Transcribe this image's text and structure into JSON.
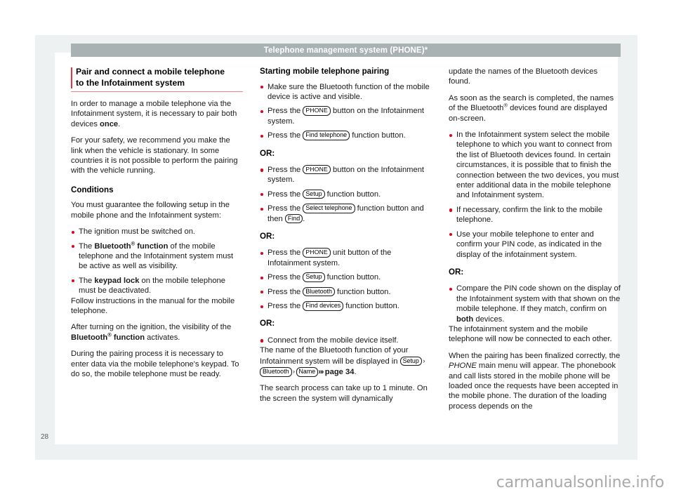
{
  "document": {
    "running_header": "Telephone management system (PHONE)*",
    "page_number": "28",
    "watermark": "carmanualsonline.info",
    "accent_color": "#e2001a",
    "header_bar_color": "#a8b2b2",
    "rule_color": "#f4808a"
  },
  "left_column": {
    "title_line1": "Pair and connect a mobile telephone",
    "title_line2": "to the Infotainment system",
    "para1_a": "In order to manage a mobile telephone via the Infotainment system, it is necessary to pair both devices ",
    "para1_bold": "once",
    "para1_b": ".",
    "para2": "For your safety, we recommend you make the link when the vehicle is stationary. In some countries it is not possible to perform the pairing with the vehicle running.",
    "conditions_heading": "Conditions",
    "para3": "You must guarantee the following setup in the mobile phone and the Infotainment system:",
    "bullet1": "The ignition must be switched on.",
    "bullet2_a": "The ",
    "bullet2_bold": "Bluetooth",
    "bullet2_sup": "®",
    "bullet2_bold2": " function",
    "bullet2_b": " of the mobile telephone and the Infotainment system must be active as well as visibility.",
    "bullet3_a": "The ",
    "bullet3_bold": "keypad lock",
    "bullet3_b": " on the mobile telephone must be deactivated.",
    "para4": "Follow instructions in the manual for the mobile telephone.",
    "para5_a": "After turning on the ignition, the visibility of the ",
    "para5_bold": "Bluetooth",
    "para5_sup": "®",
    "para5_bold2": " function",
    "para5_b": " activates.",
    "para6": "During the pairing process it is necessary to enter data via the mobile telephone's keypad. To do so, the mobile telephone must be ready."
  },
  "middle_column": {
    "heading": "Starting mobile telephone pairing",
    "group1": {
      "bullet1": "Make sure the Bluetooth function of the mobile device is active and visible.",
      "bullet2_a": "Press the ",
      "bullet2_key": "PHONE",
      "bullet2_b": " button on the Infotainment system.",
      "bullet3_a": "Press the ",
      "bullet3_key": "Find telephone",
      "bullet3_b": " function button."
    },
    "or_label_1": "OR:",
    "group2": {
      "bullet1_a": "Press the ",
      "bullet1_key": "PHONE",
      "bullet1_b": " button on the Infotainment system.",
      "bullet2_a": "Press the ",
      "bullet2_key": "Setup",
      "bullet2_b": " function button.",
      "bullet3_a": "Press the ",
      "bullet3_key": "Select telephone",
      "bullet3_b": " function button and then ",
      "bullet3_key2": "Find",
      "bullet3_c": "."
    },
    "or_label_2": "OR:",
    "group3": {
      "bullet1_a": "Press the ",
      "bullet1_key": "PHONE",
      "bullet1_b": " unit button of the Infotainment system.",
      "bullet2_a": "Press the ",
      "bullet2_key": "Setup",
      "bullet2_b": " function button.",
      "bullet3_a": "Press the ",
      "bullet3_key": "Bluetooth",
      "bullet3_b": " function button.",
      "bullet4_a": "Press the ",
      "bullet4_key": "Find devices",
      "bullet4_b": " function button."
    },
    "or_label_3": "OR:",
    "group4": {
      "bullet1": "Connect from the mobile device itself."
    },
    "para1_a": "The name of the Bluetooth function of your Infotainment system will be displayed in ",
    "para1_key1": "Setup",
    "para1_sep1": "›",
    "para1_key2": "Bluetooth",
    "para1_sep2": "›",
    "para1_key3": "Name",
    "para1_arrows": "»›",
    "para1_ref": "page 34",
    "para1_b": ".",
    "para2": "The search process can take up to 1 minute. On the screen the system will dynamically"
  },
  "right_column": {
    "para1": "update the names of the Bluetooth devices found.",
    "para2_a": "As soon as the search is completed, the names of the Bluetooth",
    "para2_sup": "®",
    "para2_b": " devices found are displayed on-screen.",
    "bullet1": "In the Infotainment system select the mobile telephone to which you want to connect from the list of Bluetooth devices found. In certain circumstances, it is possible that to finish the connection between the two devices, you must enter additional data in the mobile telephone and Infotainment system.",
    "bullet2": "If necessary, confirm the link to the mobile telephone.",
    "bullet3": "Use your mobile telephone to enter and confirm your PIN code, as indicated in the display of the infotainment system.",
    "or_label": "OR:",
    "bullet4_a": "Compare the PIN code shown on the display of the Infotainment system with that shown on the mobile telephone. If they match, confirm on ",
    "bullet4_bold": "both",
    "bullet4_b": " devices.",
    "para3": "The infotainment system and the mobile telephone will now be connected to each other.",
    "para4_a": "When the pairing has been finalized correctly, the ",
    "para4_italic": "PHONE",
    "para4_b": " main menu will appear. The phonebook and call lists stored in the mobile phone will be loaded once the requests have been accepted in the mobile phone. The duration of the loading process depends on the"
  }
}
